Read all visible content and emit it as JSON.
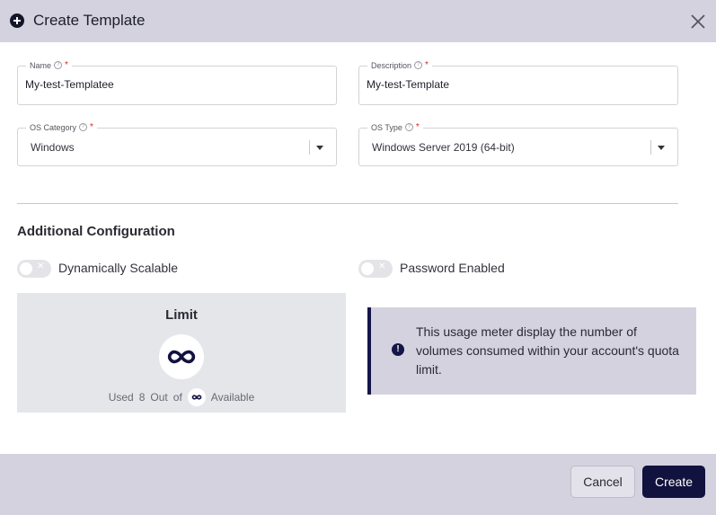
{
  "header": {
    "title": "Create Template",
    "icon": "plus-circle-icon",
    "close_icon": "close-icon"
  },
  "form": {
    "name": {
      "label": "Name",
      "required_mark": "*",
      "value": "My-test-Templatee"
    },
    "description": {
      "label": "Description",
      "required_mark": "*",
      "value": "My-test-Template"
    },
    "os_category": {
      "label": "OS Category",
      "required_mark": "*",
      "value": "Windows"
    },
    "os_type": {
      "label": "OS Type",
      "required_mark": "*",
      "value": "Windows Server 2019 (64-bit)"
    }
  },
  "additional": {
    "title": "Additional Configuration",
    "dynamically_scalable": {
      "label": "Dynamically Scalable",
      "enabled": false
    },
    "password_enabled": {
      "label": "Password Enabled",
      "enabled": false
    }
  },
  "limit": {
    "title": "Limit",
    "used_label": "Used",
    "used_value": "8",
    "out_of_label": "Out",
    "of_label": "of",
    "available_label": "Available"
  },
  "info": {
    "text": "This usage meter display the number of volumes consumed within your account's quota limit."
  },
  "footer": {
    "cancel_label": "Cancel",
    "create_label": "Create"
  },
  "colors": {
    "header_bg": "#d3d2de",
    "primary": "#12123f",
    "required": "#d62828",
    "card_bg": "#e4e6ea"
  }
}
